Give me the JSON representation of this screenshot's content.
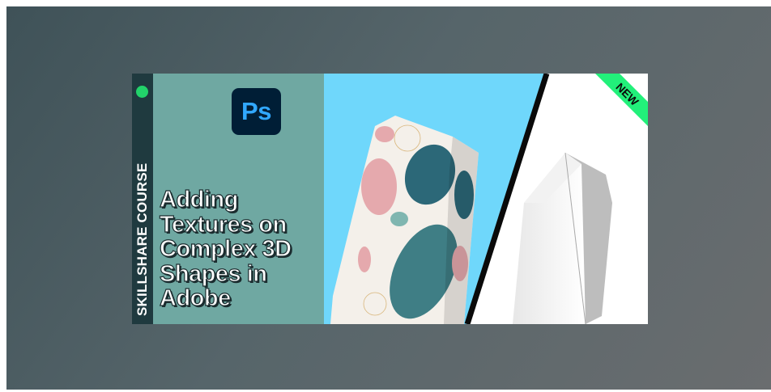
{
  "thumbnail": {
    "badge_label": "SKILLSHARE COURSE",
    "app_logo_text": "Ps",
    "app_logo_icon": "photoshop-icon",
    "title_lines": [
      "Adding",
      "Textures on",
      "Complex 3D",
      "Shapes in",
      "Adobe"
    ],
    "ribbon_label": "NEW",
    "colors": {
      "strip": "#1f3a3f",
      "status_dot": "#22d36a",
      "teal_panel": "#6fa8a2",
      "sky_panel": "#6fd7fb",
      "ribbon": "#22f07a",
      "logo_bg": "#001e36",
      "logo_text": "#31a8ff"
    }
  }
}
